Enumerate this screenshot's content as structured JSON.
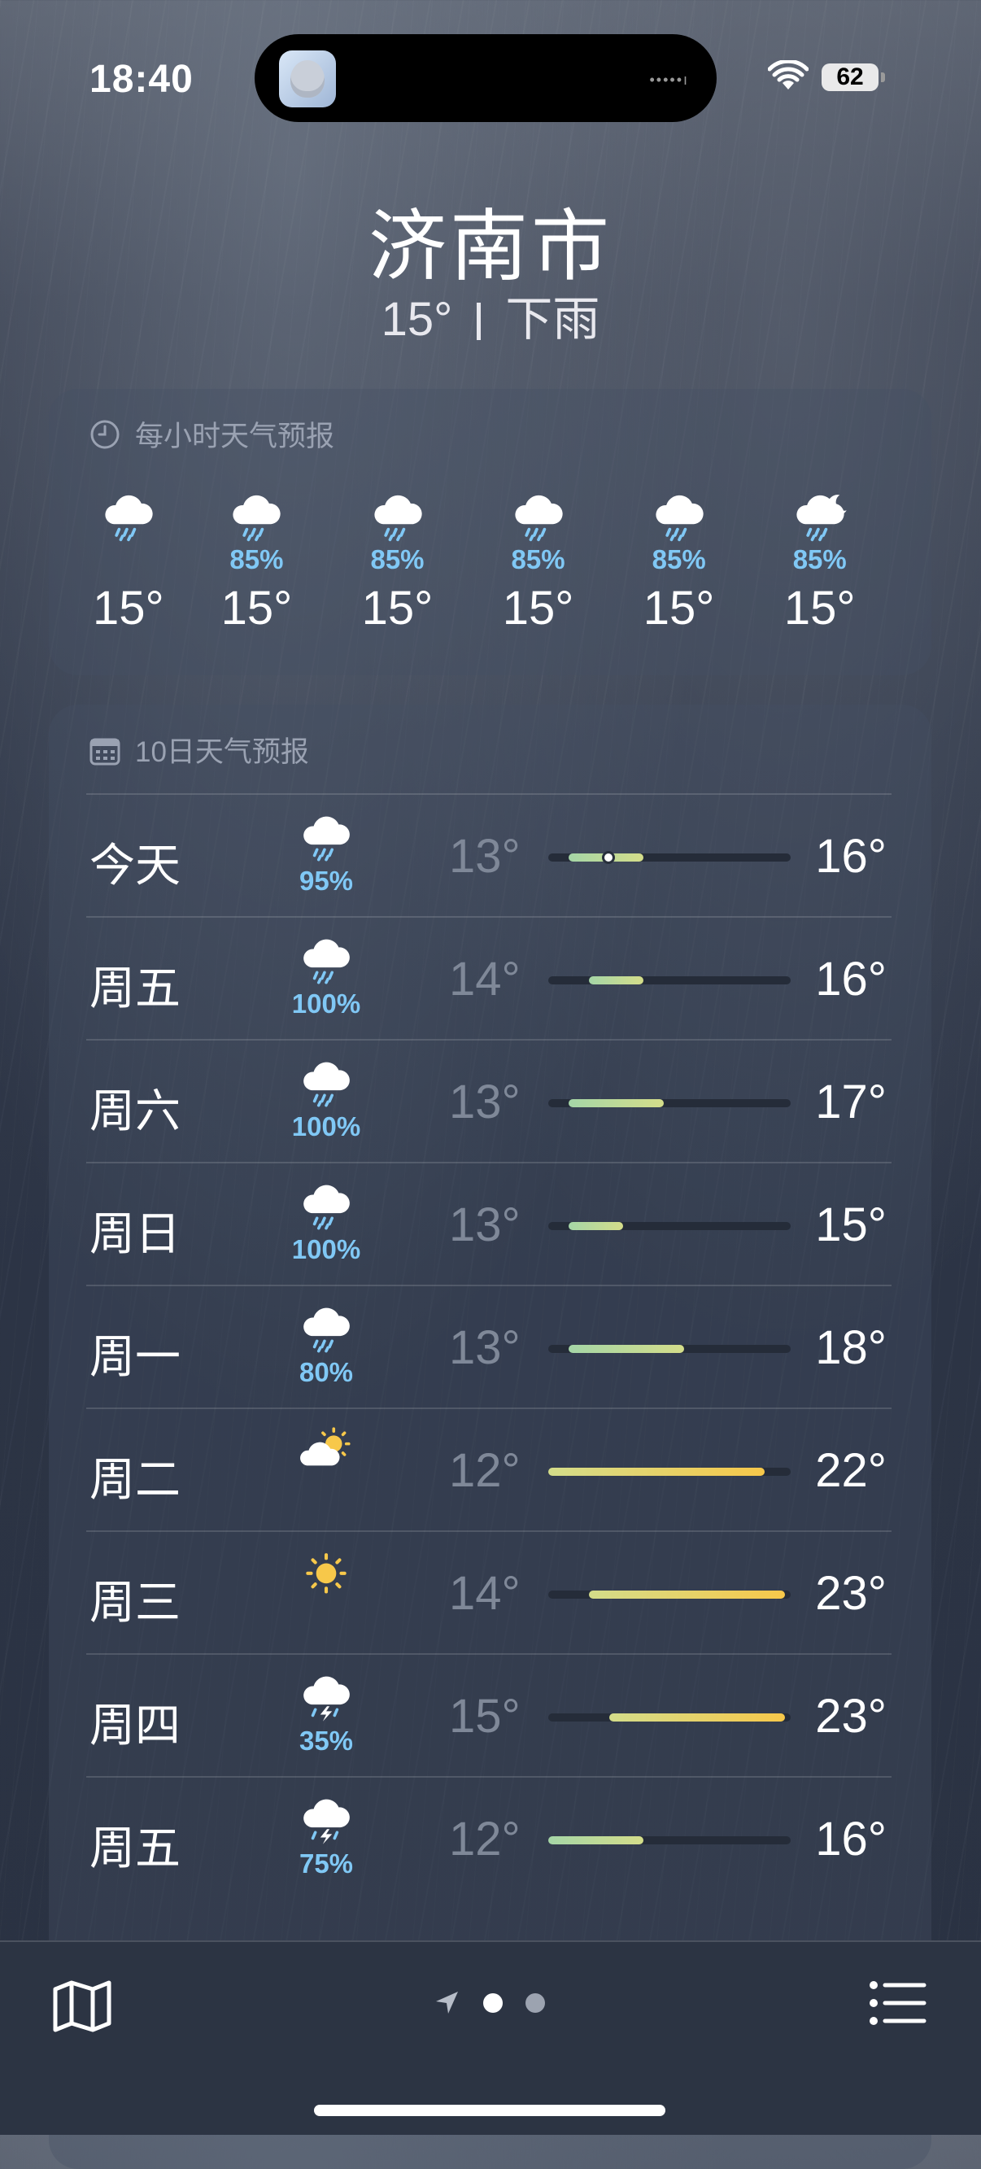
{
  "status": {
    "time": "18:40",
    "battery": "62"
  },
  "header": {
    "city": "济南市",
    "temp": "15°",
    "condition": "下雨"
  },
  "hourly": {
    "title": "每小时天气预报",
    "items": [
      {
        "icon": "rain-cloud-icon",
        "pop": "",
        "temp": "15°"
      },
      {
        "icon": "rain-cloud-icon",
        "pop": "85%",
        "temp": "15°"
      },
      {
        "icon": "rain-cloud-icon",
        "pop": "85%",
        "temp": "15°"
      },
      {
        "icon": "rain-cloud-icon",
        "pop": "85%",
        "temp": "15°"
      },
      {
        "icon": "rain-cloud-icon",
        "pop": "85%",
        "temp": "15°"
      },
      {
        "icon": "moon-rain-cloud-icon",
        "pop": "85%",
        "temp": "15°"
      }
    ]
  },
  "daily": {
    "title": "10日天气预报",
    "rows": [
      {
        "day": "今天",
        "icon": "rain-cloud-icon",
        "pop": "95%",
        "low": "13°",
        "high": "16°"
      },
      {
        "day": "周五",
        "icon": "rain-cloud-icon",
        "pop": "100%",
        "low": "14°",
        "high": "16°"
      },
      {
        "day": "周六",
        "icon": "rain-cloud-icon",
        "pop": "100%",
        "low": "13°",
        "high": "17°"
      },
      {
        "day": "周日",
        "icon": "rain-cloud-icon",
        "pop": "100%",
        "low": "13°",
        "high": "15°"
      },
      {
        "day": "周一",
        "icon": "rain-cloud-icon",
        "pop": "80%",
        "low": "13°",
        "high": "18°"
      },
      {
        "day": "周二",
        "icon": "partly-sunny-icon",
        "pop": "",
        "low": "12°",
        "high": "22°"
      },
      {
        "day": "周三",
        "icon": "sun-icon",
        "pop": "",
        "low": "14°",
        "high": "23°"
      },
      {
        "day": "周四",
        "icon": "thunderstorm-cloud-icon",
        "pop": "35%",
        "low": "15°",
        "high": "23°"
      },
      {
        "day": "周五",
        "icon": "thunderstorm-cloud-icon",
        "pop": "75%",
        "low": "12°",
        "high": "16°"
      }
    ]
  },
  "colors": {
    "cool": "#a5d6a7",
    "mid": "#d4dd8a",
    "warm": "#f7c84a",
    "pop": "#80c8f5"
  }
}
